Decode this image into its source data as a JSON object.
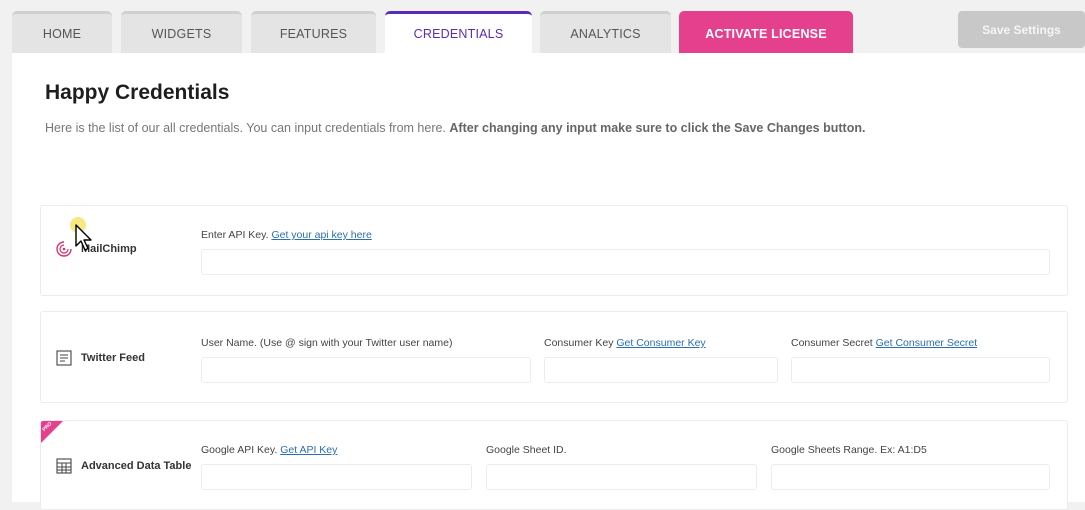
{
  "tabs": [
    {
      "label": "HOME",
      "active": false
    },
    {
      "label": "WIDGETS",
      "active": false
    },
    {
      "label": "FEATURES",
      "active": false
    },
    {
      "label": "CREDENTIALS",
      "active": true
    },
    {
      "label": "ANALYTICS",
      "active": false
    }
  ],
  "activate_license": "ACTIVATE LICENSE",
  "save_settings": "Save Settings",
  "page": {
    "title": "Happy Credentials",
    "description": "Here is the list of our all credentials. You can input credentials from here. ",
    "description_bold": "After changing any input make sure to click the Save Changes button."
  },
  "cards": {
    "mailchimp": {
      "name": "MailChimp",
      "icon": "mailchimp-icon",
      "fields": [
        {
          "label": "Enter API Key. ",
          "link": "Get your api key here",
          "value": ""
        }
      ]
    },
    "twitter": {
      "name": "Twitter Feed",
      "icon": "twitter-feed-icon",
      "fields": [
        {
          "label": "User Name. (Use @ sign with your Twitter user name)",
          "link": "",
          "value": ""
        },
        {
          "label": "Consumer Key ",
          "link": "Get Consumer Key",
          "value": ""
        },
        {
          "label": "Consumer Secret ",
          "link": "Get Consumer Secret",
          "value": ""
        }
      ]
    },
    "advanced_table": {
      "name": "Advanced Data Table",
      "icon": "data-table-icon",
      "badge": "PRO",
      "fields": [
        {
          "label": "Google API Key. ",
          "link": "Get API Key",
          "value": ""
        },
        {
          "label": "Google Sheet ID.",
          "link": "",
          "value": ""
        },
        {
          "label": "Google Sheets Range. Ex: A1:D5",
          "link": "",
          "value": ""
        }
      ]
    }
  },
  "colors": {
    "accent": "#5b2bb5",
    "license": "#e4408e",
    "link": "#2a6fb0"
  }
}
